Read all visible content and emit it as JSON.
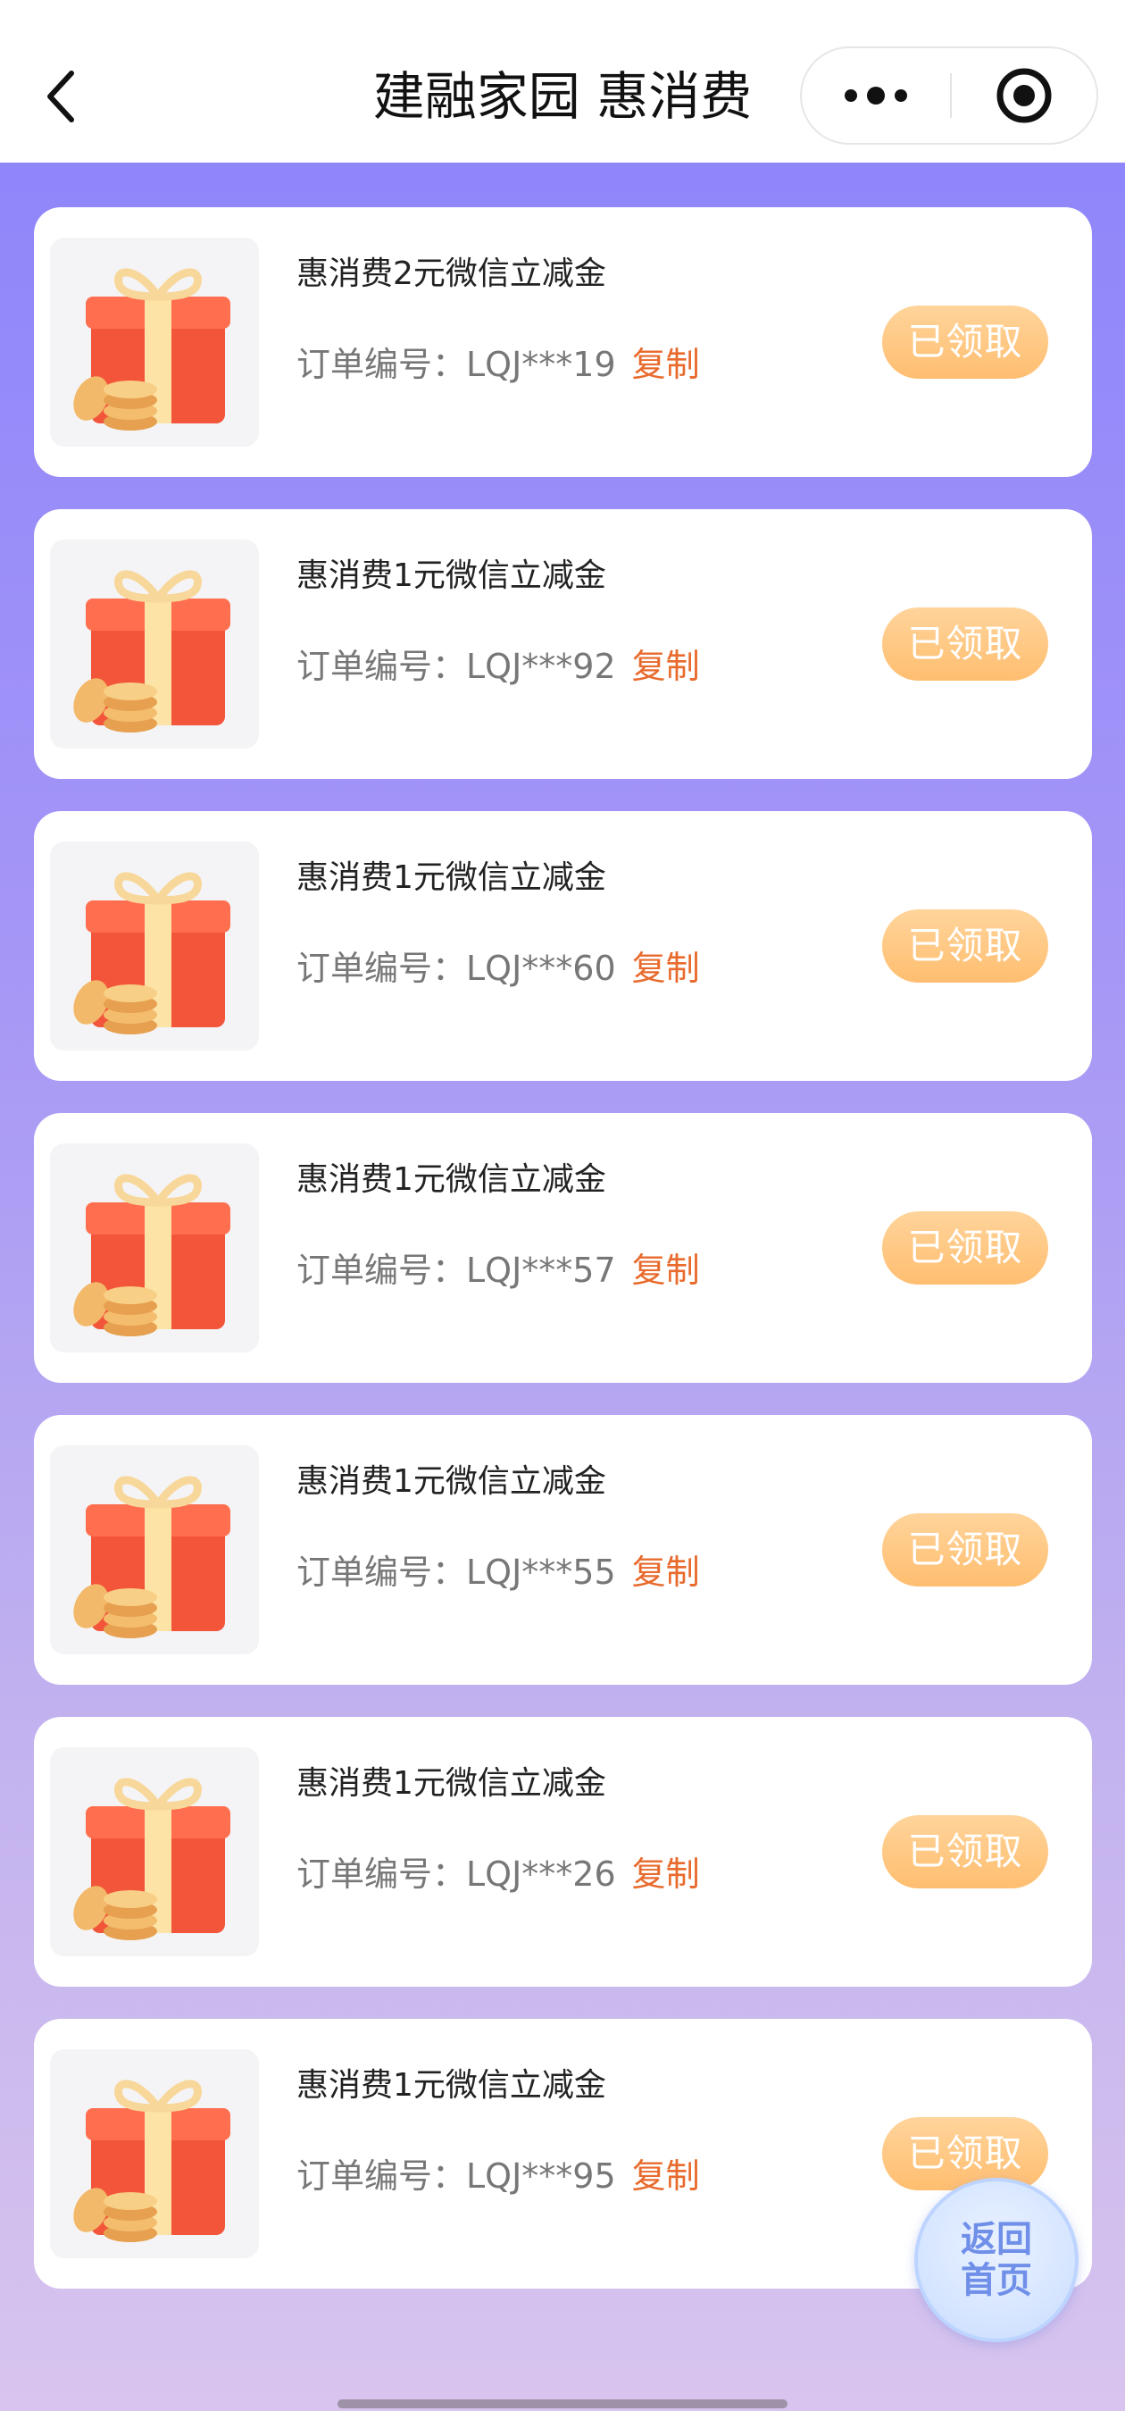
{
  "navbar": {
    "title": "建融家园 惠消费",
    "back_icon": "chevron-left-icon",
    "more_icon": "more-dots-icon",
    "close_icon": "target-circle-icon"
  },
  "colors": {
    "background_top": "#8f86fb",
    "background_bottom": "#d8c4ee",
    "copy_link": "#e86a2c",
    "claimed_button": "#ffc67f",
    "home_button_text": "#6f8fe8"
  },
  "coupons": [
    {
      "title": "惠消费2元微信立减金",
      "order_label": "订单编号：",
      "order_no": "LQJ***19",
      "copy_label": "复制",
      "status": "已领取"
    },
    {
      "title": "惠消费1元微信立减金",
      "order_label": "订单编号：",
      "order_no": "LQJ***92",
      "copy_label": "复制",
      "status": "已领取"
    },
    {
      "title": "惠消费1元微信立减金",
      "order_label": "订单编号：",
      "order_no": "LQJ***60",
      "copy_label": "复制",
      "status": "已领取"
    },
    {
      "title": "惠消费1元微信立减金",
      "order_label": "订单编号：",
      "order_no": "LQJ***57",
      "copy_label": "复制",
      "status": "已领取"
    },
    {
      "title": "惠消费1元微信立减金",
      "order_label": "订单编号：",
      "order_no": "LQJ***55",
      "copy_label": "复制",
      "status": "已领取"
    },
    {
      "title": "惠消费1元微信立减金",
      "order_label": "订单编号：",
      "order_no": "LQJ***26",
      "copy_label": "复制",
      "status": "已领取"
    },
    {
      "title": "惠消费1元微信立减金",
      "order_label": "订单编号：",
      "order_no": "LQJ***95",
      "copy_label": "复制",
      "status": "已领取"
    }
  ],
  "home_button": {
    "line1": "返回",
    "line2": "首页"
  }
}
